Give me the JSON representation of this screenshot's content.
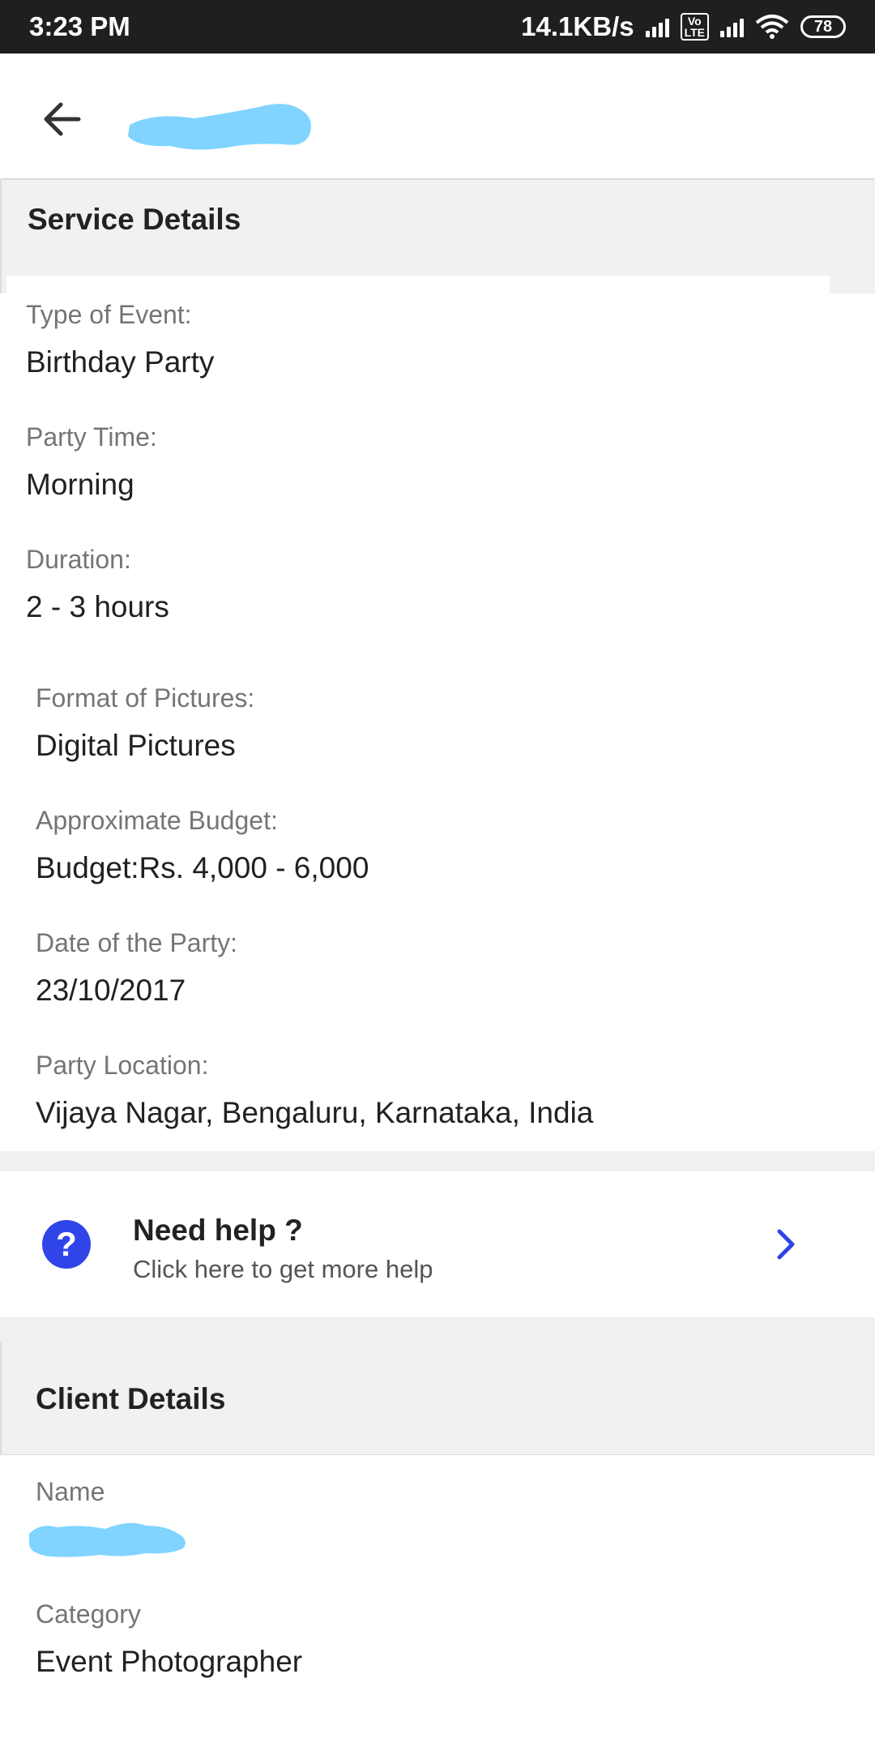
{
  "status_bar": {
    "time": "3:23 PM",
    "network_speed": "14.1KB/s",
    "volte": "Vo\nLTE",
    "battery": "78"
  },
  "app_bar": {
    "back_icon": "arrow-left-icon",
    "title_redacted_color": "#80d4ff"
  },
  "service_details": {
    "title": "Service Details",
    "fields": [
      {
        "label": "Type of Event:",
        "value": "Birthday Party"
      },
      {
        "label": "Party Time:",
        "value": "Morning"
      },
      {
        "label": "Duration:",
        "value": "2 - 3 hours"
      },
      {
        "label": "Format of Pictures:",
        "value": "Digital Pictures"
      },
      {
        "label": "Approximate Budget:",
        "value": "Budget:Rs. 4,000 - 6,000"
      },
      {
        "label": "Date of the Party:",
        "value": "23/10/2017"
      },
      {
        "label": "Party Location:",
        "value": "Vijaya Nagar, Bengaluru, Karnataka, India"
      }
    ]
  },
  "help": {
    "icon": "question-circle-icon",
    "title": "Need help ?",
    "subtitle": "Click here to get more help",
    "chevron_icon": "chevron-right-icon",
    "accent_color": "#2f45e8"
  },
  "client_details": {
    "title": "Client Details",
    "fields": [
      {
        "label": "Name",
        "value": ""
      },
      {
        "label": "Category",
        "value": "Event Photographer"
      }
    ]
  }
}
